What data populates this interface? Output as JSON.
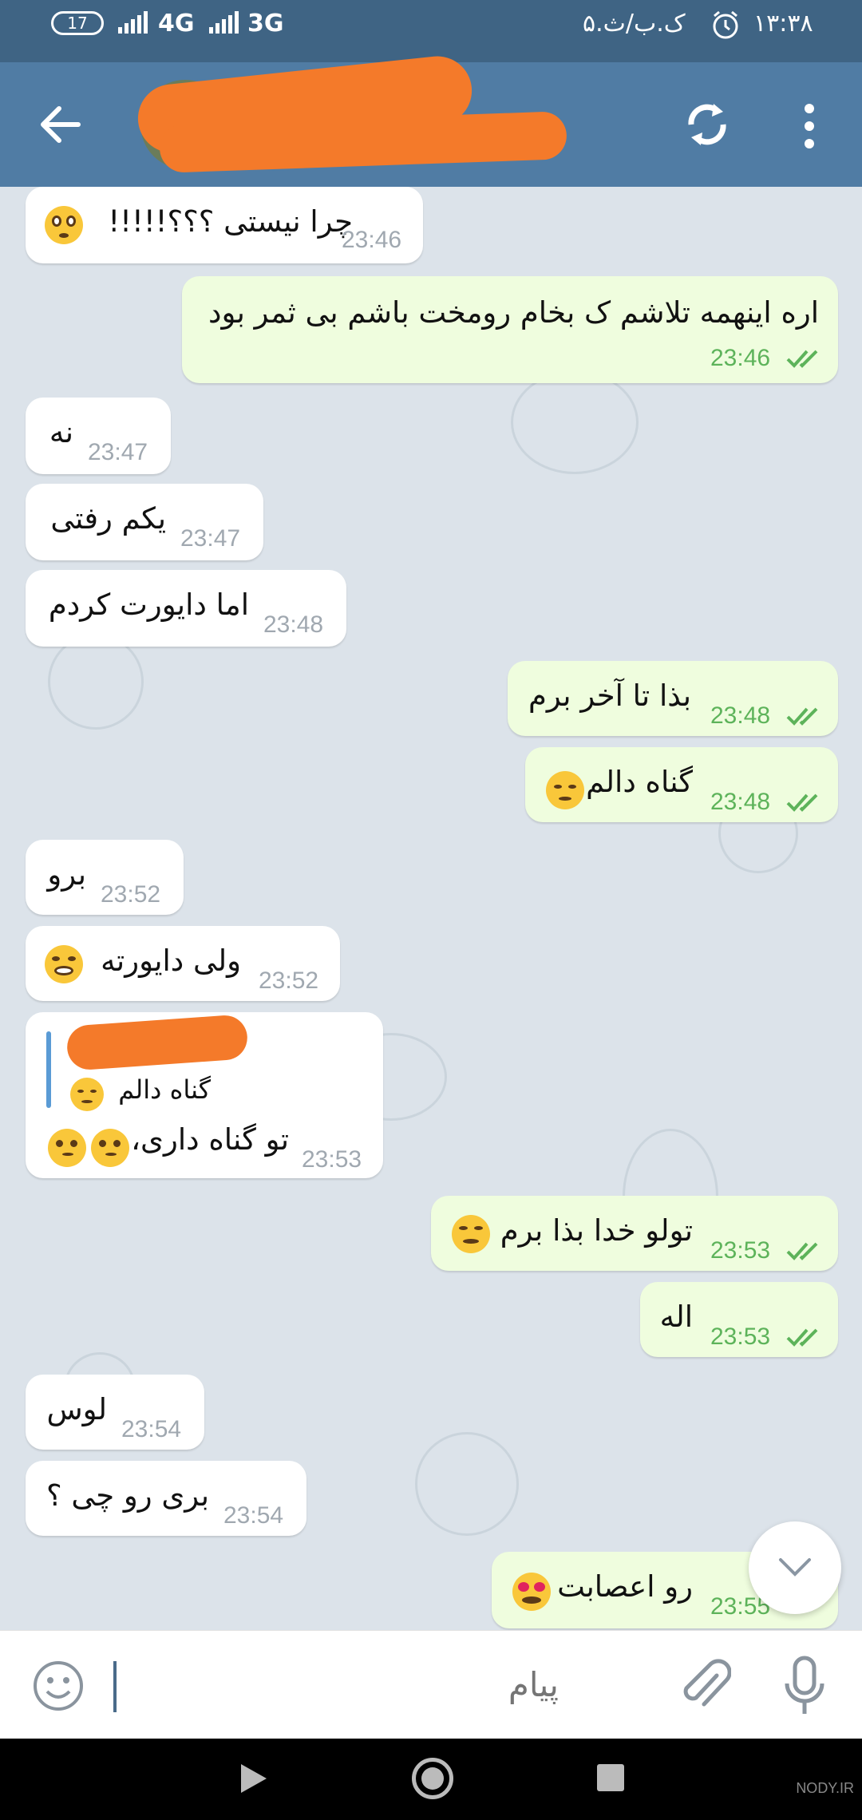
{
  "status_bar": {
    "battery": "17",
    "network1": "4G",
    "network2": "3G",
    "date": "۵.ک.ب/ث",
    "time": "۱۳:۳۸"
  },
  "header": {
    "back_icon": "arrow-left-icon",
    "refresh_icon": "refresh-icon",
    "menu_icon": "more-vertical-icon"
  },
  "messages": [
    {
      "dir": "in",
      "text": "چرا نیستی ؟؟؟!!!!!",
      "emoji": "flushed",
      "time": "23:46"
    },
    {
      "dir": "out",
      "text": "اره اینهمه تلاشم ک بخام رومخت باشم بی ثمر بود",
      "time": "23:46"
    },
    {
      "dir": "in",
      "text": "نه",
      "time": "23:47"
    },
    {
      "dir": "in",
      "text": "یکم رفتی",
      "time": "23:47"
    },
    {
      "dir": "in",
      "text": "اما دایورت کردم",
      "time": "23:48"
    },
    {
      "dir": "out",
      "text": "بذا تا آخر برم",
      "time": "23:48"
    },
    {
      "dir": "out",
      "text": "گناه دالم",
      "emoji": "disappointed",
      "time": "23:48"
    },
    {
      "dir": "in",
      "text": "برو",
      "time": "23:52"
    },
    {
      "dir": "in",
      "text": "ولی دایورته",
      "emoji": "joy",
      "time": "23:52"
    },
    {
      "dir": "in",
      "quote": "گناه دالم",
      "quote_emoji": "disappointed",
      "text": "تو گناه داری،",
      "emoji": "thinking",
      "time": "23:53"
    },
    {
      "dir": "out",
      "text": "تولو خدا بذا برم",
      "emoji": "persevere",
      "time": "23:53"
    },
    {
      "dir": "out",
      "text": "اله",
      "time": "23:53"
    },
    {
      "dir": "in",
      "text": "لوس",
      "time": "23:54"
    },
    {
      "dir": "in",
      "text": "بری رو چی ؟",
      "time": "23:54"
    },
    {
      "dir": "out",
      "text": "رو اعصابت",
      "emoji": "heart-eyes",
      "time": "23:55"
    }
  ],
  "input": {
    "placeholder": "پیام",
    "emoji_icon": "smile-icon",
    "attach_icon": "paperclip-icon",
    "mic_icon": "microphone-icon"
  },
  "watermark": "NODY.IR",
  "colors": {
    "header": "#507ca4",
    "status_bar": "#3f6484",
    "incoming": "#ffffff",
    "outgoing": "#effdde",
    "time_out": "#5db35a"
  }
}
